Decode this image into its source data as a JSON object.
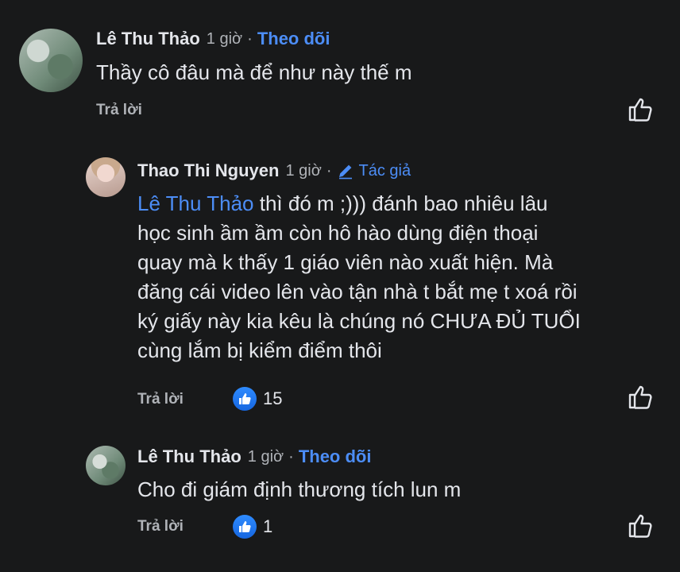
{
  "comments": [
    {
      "name": "Lê Thu Thảo",
      "time": "1 giờ",
      "badge": "Theo dõi",
      "text": "Thầy cô đâu mà để như này thế m",
      "reply": "Trả lời"
    },
    {
      "name": "Thao Thi Nguyen",
      "time": "1 giờ",
      "badge": "Tác giả",
      "mention": "Lê Thu Thảo",
      "line1": " thì đó m ;))) đánh bao nhiêu lâu",
      "line2": "học sinh ầm ầm còn hô hào dùng điện thoại",
      "line3": "quay mà k thấy 1 giáo viên nào xuất hiện. Mà",
      "line4": "đăng cái video lên vào tận nhà t bắt mẹ t xoá rồi",
      "line5": "ký giấy này kia kêu là chúng nó CHƯA ĐỦ TUỔI",
      "line6": "cùng lắm bị kiểm điểm thôi",
      "reply": "Trả lời",
      "likes": "15"
    },
    {
      "name": "Lê Thu Thảo",
      "time": "1 giờ",
      "badge": "Theo dõi",
      "text": "Cho đi giám định thương tích lun m",
      "reply": "Trả lời",
      "likes": "1"
    }
  ],
  "colors": {
    "background": "#18191a",
    "link": "#4c8df6",
    "muted": "#b0b3b8"
  }
}
